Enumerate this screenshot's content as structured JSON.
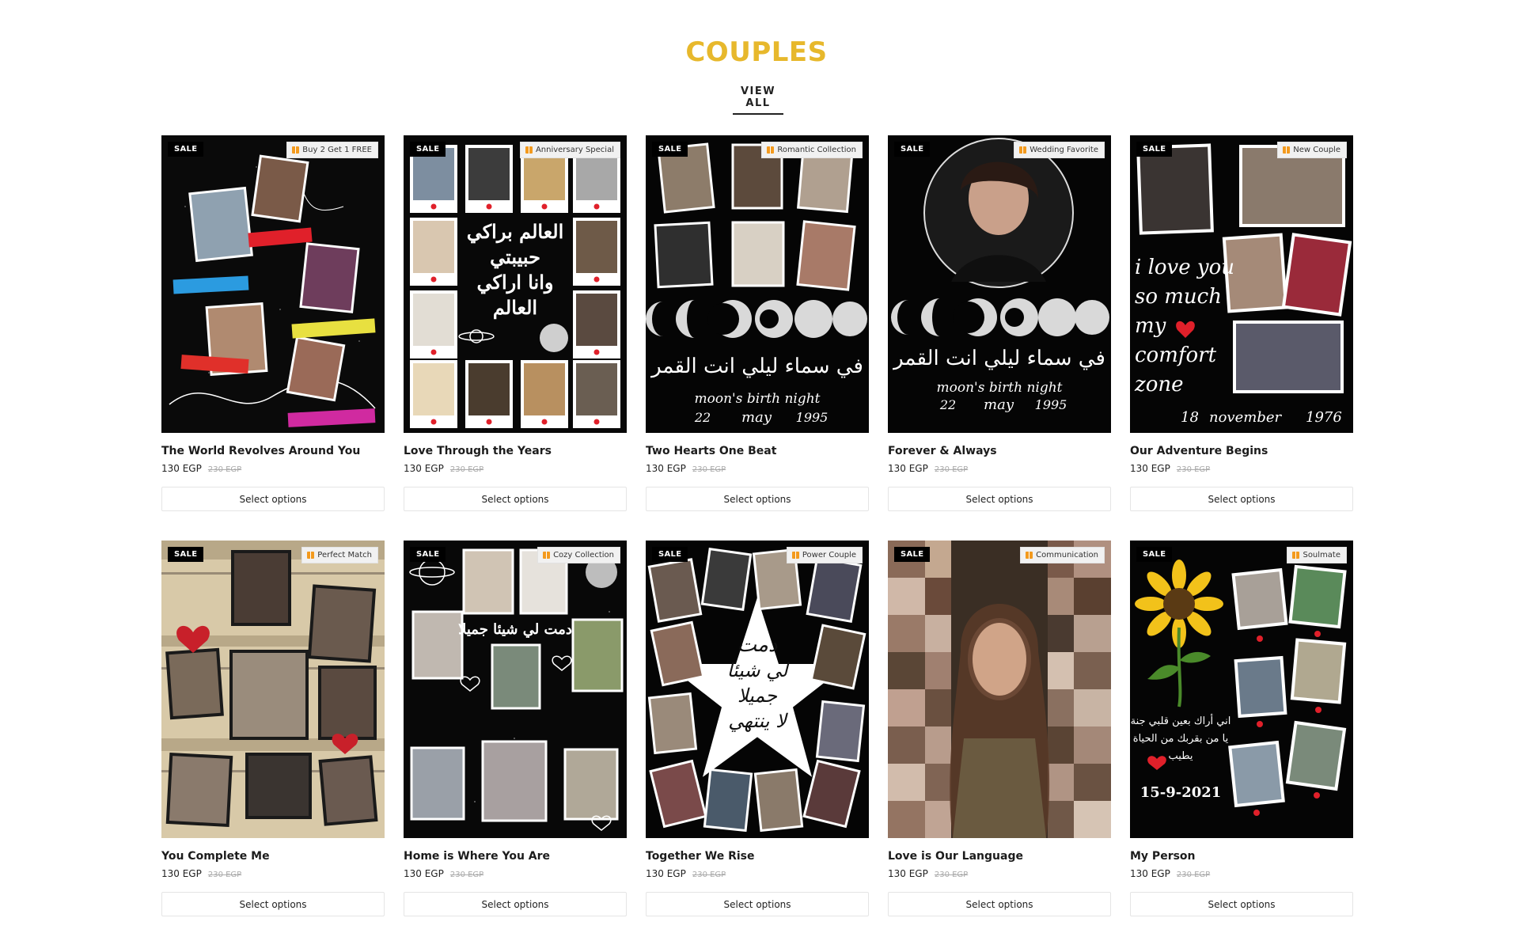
{
  "section": {
    "title": "COUPLES",
    "view_all": "VIEW ALL"
  },
  "colors": {
    "accent": "#e7b82c",
    "thumb_bg": "#0b0b0b",
    "sale_bg": "#000000",
    "heart": "#e0202a"
  },
  "products": [
    {
      "title": "The World Revolves Around You",
      "price": "130 EGP",
      "old_price": "230 EGP",
      "sale": "SALE",
      "ribbon": "Buy 2 Get 1 FREE",
      "button": "Select options",
      "art_theme": "collage-sticker"
    },
    {
      "title": "Love Through the Years",
      "price": "130 EGP",
      "old_price": "230 EGP",
      "sale": "SALE",
      "ribbon": "Anniversary Special",
      "button": "Select options",
      "art_theme": "polaroid-grid",
      "art_text": [
        "العالم براكي",
        "حبيبتي",
        "وانا اراكي",
        "العالم"
      ]
    },
    {
      "title": "Two Hearts One Beat",
      "price": "130 EGP",
      "old_price": "230 EGP",
      "sale": "SALE",
      "ribbon": "Romantic Collection",
      "button": "Select options",
      "art_theme": "moon-phases",
      "art_text": [
        "في سماء ليلي انت القمر",
        "moon's birth night",
        "22",
        "may",
        "1995"
      ]
    },
    {
      "title": "Forever & Always",
      "price": "130 EGP",
      "old_price": "230 EGP",
      "sale": "SALE",
      "ribbon": "Wedding Favorite",
      "button": "Select options",
      "art_theme": "moon-portrait",
      "art_text": [
        "في سماء ليلي انت القمر",
        "moon's birth night",
        "22",
        "may",
        "1995"
      ]
    },
    {
      "title": "Our Adventure Begins",
      "price": "130 EGP",
      "old_price": "230 EGP",
      "sale": "SALE",
      "ribbon": "New Couple",
      "button": "Select options",
      "art_theme": "script-polaroids",
      "art_text": [
        "i love you",
        "so much",
        "my",
        "comfort",
        "zone",
        "18",
        "november",
        "1976"
      ]
    },
    {
      "title": "You Complete Me",
      "price": "130 EGP",
      "old_price": "230 EGP",
      "sale": "SALE",
      "ribbon": "Perfect Match",
      "button": "Select options",
      "art_theme": "vintage-collage"
    },
    {
      "title": "Home is Where You Are",
      "price": "130 EGP",
      "old_price": "230 EGP",
      "sale": "SALE",
      "ribbon": "Cozy Collection",
      "button": "Select options",
      "art_theme": "space-doodle",
      "art_text": [
        "دمت لي شيئا جميلا"
      ]
    },
    {
      "title": "Together We Rise",
      "price": "130 EGP",
      "old_price": "230 EGP",
      "sale": "SALE",
      "ribbon": "Power Couple",
      "button": "Select options",
      "art_theme": "star-frame",
      "art_text": [
        "دمت",
        "لي شيئا",
        "جميلا",
        "لا ينتهي"
      ]
    },
    {
      "title": "Love is Our Language",
      "price": "130 EGP",
      "old_price": "230 EGP",
      "sale": "SALE",
      "ribbon": "Communication",
      "button": "Select options",
      "art_theme": "mosaic-portrait"
    },
    {
      "title": "My Person",
      "price": "130 EGP",
      "old_price": "230 EGP",
      "sale": "SALE",
      "ribbon": "Soulmate",
      "button": "Select options",
      "art_theme": "sunflower",
      "art_text": [
        "اني أراك بعين قلبي جنة",
        "يا من بقربك من الحياة",
        "يطيب",
        "15-9-2021"
      ]
    }
  ]
}
